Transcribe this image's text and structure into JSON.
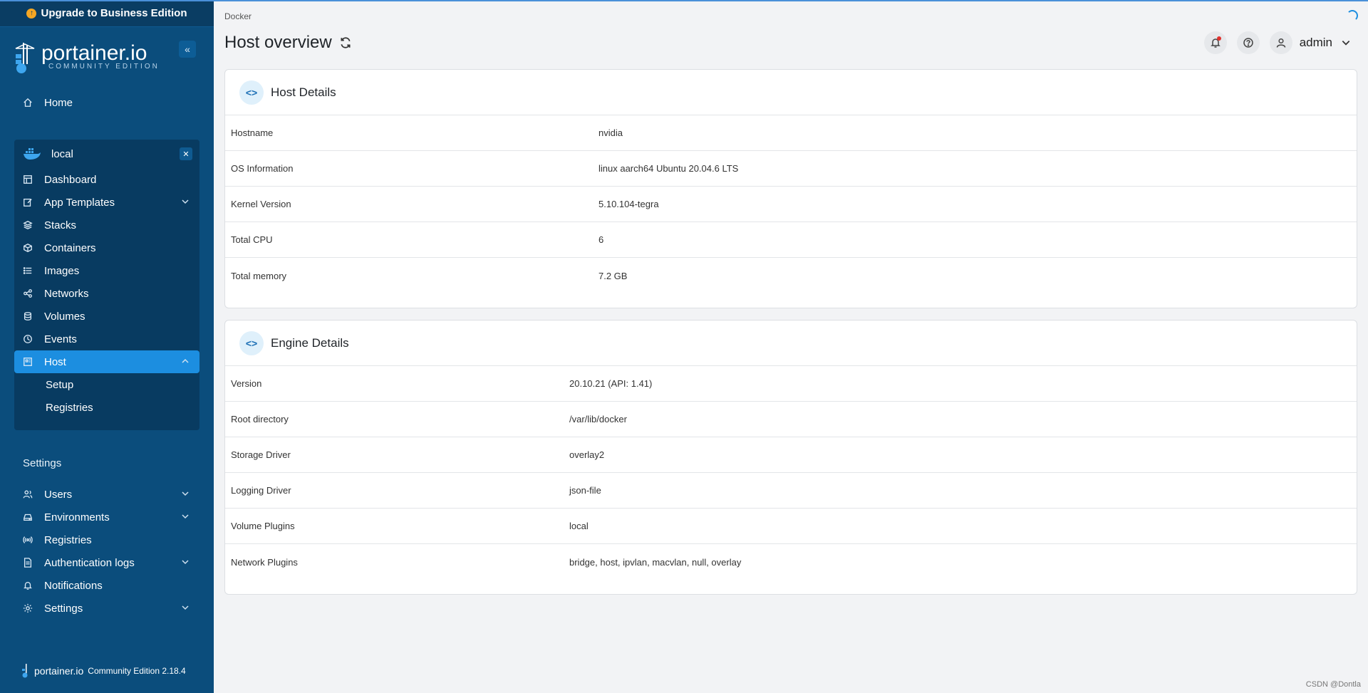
{
  "upgrade": {
    "label": "Upgrade to Business Edition"
  },
  "brand": {
    "name": "portainer.io",
    "sub": "COMMUNITY EDITION"
  },
  "nav": {
    "home": "Home"
  },
  "environment": {
    "name": "local",
    "items": [
      {
        "label": "Dashboard"
      },
      {
        "label": "App Templates"
      },
      {
        "label": "Stacks"
      },
      {
        "label": "Containers"
      },
      {
        "label": "Images"
      },
      {
        "label": "Networks"
      },
      {
        "label": "Volumes"
      },
      {
        "label": "Events"
      },
      {
        "label": "Host"
      }
    ],
    "host_sub": [
      {
        "label": "Setup"
      },
      {
        "label": "Registries"
      }
    ]
  },
  "settings": {
    "heading": "Settings",
    "items": [
      {
        "label": "Users"
      },
      {
        "label": "Environments"
      },
      {
        "label": "Registries"
      },
      {
        "label": "Authentication logs"
      },
      {
        "label": "Notifications"
      },
      {
        "label": "Settings"
      }
    ]
  },
  "footer": {
    "brand": "portainer.io",
    "edition": "Community Edition 2.18.4"
  },
  "header": {
    "breadcrumb": "Docker",
    "title": "Host overview",
    "user": "admin"
  },
  "host_details": {
    "title": "Host Details",
    "rows": [
      {
        "key": "Hostname",
        "value": "nvidia"
      },
      {
        "key": "OS Information",
        "value": "linux aarch64 Ubuntu 20.04.6 LTS"
      },
      {
        "key": "Kernel Version",
        "value": "5.10.104-tegra"
      },
      {
        "key": "Total CPU",
        "value": "6"
      },
      {
        "key": "Total memory",
        "value": "7.2 GB"
      }
    ]
  },
  "engine_details": {
    "title": "Engine Details",
    "rows": [
      {
        "key": "Version",
        "value": "20.10.21 (API: 1.41)"
      },
      {
        "key": "Root directory",
        "value": "/var/lib/docker"
      },
      {
        "key": "Storage Driver",
        "value": "overlay2"
      },
      {
        "key": "Logging Driver",
        "value": "json-file"
      },
      {
        "key": "Volume Plugins",
        "value": "local"
      },
      {
        "key": "Network Plugins",
        "value": "bridge, host, ipvlan, macvlan, null, overlay"
      }
    ]
  },
  "watermark": "CSDN @Dontla",
  "colors": {
    "sidebar": "#0b4d7c",
    "active": "#1c8ee0",
    "accent": "#f5a623"
  }
}
